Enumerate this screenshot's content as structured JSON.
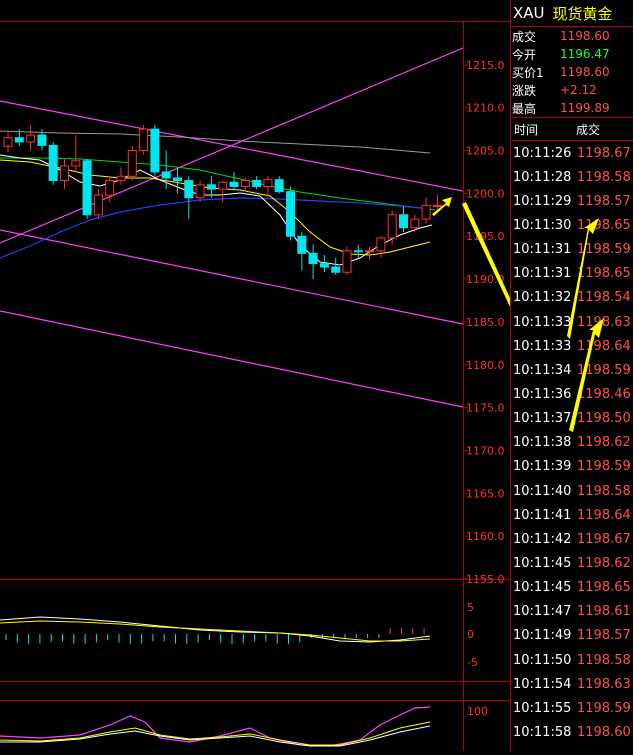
{
  "quote": {
    "symbol": "XAU",
    "name": "现货黄金",
    "rows": [
      {
        "label": "成交",
        "value": "1198.60",
        "color": "#ff5050"
      },
      {
        "label": "今开",
        "value": "1196.47",
        "color": "#20ff20"
      },
      {
        "label": "买价1",
        "value": "1198.60",
        "color": "#ff5050"
      },
      {
        "label": "涨跌",
        "value": "+2.12",
        "color": "#ff5050"
      },
      {
        "label": "最高",
        "value": "1199.89",
        "color": "#ff5050"
      }
    ]
  },
  "ticks_header": {
    "time": "时间",
    "price": "成交"
  },
  "ticks": [
    {
      "time": "10:11:26",
      "price": "1198.67"
    },
    {
      "time": "10:11:28",
      "price": "1198.58"
    },
    {
      "time": "10:11:29",
      "price": "1198.57"
    },
    {
      "time": "10:11:30",
      "price": "1198.65"
    },
    {
      "time": "10:11:31",
      "price": "1198.59"
    },
    {
      "time": "10:11:31",
      "price": "1198.65"
    },
    {
      "time": "10:11:32",
      "price": "1198.54"
    },
    {
      "time": "10:11:33",
      "price": "1198.63"
    },
    {
      "time": "10:11:33",
      "price": "1198.64"
    },
    {
      "time": "10:11:34",
      "price": "1198.59"
    },
    {
      "time": "10:11:36",
      "price": "1198.46"
    },
    {
      "time": "10:11:37",
      "price": "1198.50"
    },
    {
      "time": "10:11:38",
      "price": "1198.62"
    },
    {
      "time": "10:11:39",
      "price": "1198.59"
    },
    {
      "time": "10:11:40",
      "price": "1198.58"
    },
    {
      "time": "10:11:41",
      "price": "1198.64"
    },
    {
      "time": "10:11:42",
      "price": "1198.67"
    },
    {
      "time": "10:11:45",
      "price": "1198.62"
    },
    {
      "time": "10:11:45",
      "price": "1198.65"
    },
    {
      "time": "10:11:47",
      "price": "1198.61"
    },
    {
      "time": "10:11:49",
      "price": "1198.57"
    },
    {
      "time": "10:11:50",
      "price": "1198.58"
    },
    {
      "time": "10:11:54",
      "price": "1198.63"
    },
    {
      "time": "10:11:55",
      "price": "1198.59"
    },
    {
      "time": "10:11:58",
      "price": "1198.60"
    }
  ],
  "chart_data": {
    "type": "candlestick",
    "ylim": [
      1155,
      1220
    ],
    "yticks": [
      "1215.0",
      "1210.0",
      "1205.0",
      "1200.0",
      "1195.0",
      "1190.0",
      "1185.0",
      "1180.0",
      "1175.0",
      "1170.0",
      "1165.0",
      "1160.0",
      "1155.0"
    ],
    "colors": {
      "up": "#ff3030",
      "down": "#00e5ee",
      "grid": "#b00000",
      "channel": "#ff40ff",
      "ma1": "#ffffff",
      "ma2": "#ffff00",
      "ma3": "#00dd00",
      "ma4": "#2040ff"
    },
    "candles": [
      {
        "o": 1205.5,
        "h": 1207.2,
        "l": 1204.8,
        "c": 1206.5
      },
      {
        "o": 1206.5,
        "h": 1207.5,
        "l": 1205.5,
        "c": 1206.0
      },
      {
        "o": 1206.0,
        "h": 1208.0,
        "l": 1205.0,
        "c": 1206.8
      },
      {
        "o": 1206.8,
        "h": 1207.5,
        "l": 1205.0,
        "c": 1205.6
      },
      {
        "o": 1205.6,
        "h": 1206.0,
        "l": 1201.0,
        "c": 1201.5
      },
      {
        "o": 1201.5,
        "h": 1204.0,
        "l": 1200.5,
        "c": 1203.2
      },
      {
        "o": 1203.2,
        "h": 1206.8,
        "l": 1202.5,
        "c": 1203.8
      },
      {
        "o": 1203.8,
        "h": 1204.0,
        "l": 1197.0,
        "c": 1197.5
      },
      {
        "o": 1197.5,
        "h": 1200.5,
        "l": 1197.0,
        "c": 1199.8
      },
      {
        "o": 1199.8,
        "h": 1202.0,
        "l": 1199.0,
        "c": 1201.5
      },
      {
        "o": 1201.5,
        "h": 1203.0,
        "l": 1201.0,
        "c": 1202.0
      },
      {
        "o": 1202.0,
        "h": 1205.5,
        "l": 1201.5,
        "c": 1205.0
      },
      {
        "o": 1205.0,
        "h": 1208.0,
        "l": 1204.5,
        "c": 1207.5
      },
      {
        "o": 1207.5,
        "h": 1208.0,
        "l": 1202.0,
        "c": 1202.5
      },
      {
        "o": 1202.5,
        "h": 1205.0,
        "l": 1200.5,
        "c": 1201.8
      },
      {
        "o": 1201.8,
        "h": 1203.0,
        "l": 1200.0,
        "c": 1201.5
      },
      {
        "o": 1201.5,
        "h": 1202.0,
        "l": 1197.0,
        "c": 1199.5
      },
      {
        "o": 1199.5,
        "h": 1201.5,
        "l": 1199.0,
        "c": 1201.0
      },
      {
        "o": 1201.0,
        "h": 1202.0,
        "l": 1199.5,
        "c": 1200.5
      },
      {
        "o": 1200.5,
        "h": 1201.5,
        "l": 1199.0,
        "c": 1201.3
      },
      {
        "o": 1201.3,
        "h": 1202.5,
        "l": 1200.5,
        "c": 1200.8
      },
      {
        "o": 1200.8,
        "h": 1201.8,
        "l": 1200.2,
        "c": 1201.5
      },
      {
        "o": 1201.5,
        "h": 1202.0,
        "l": 1200.5,
        "c": 1200.8
      },
      {
        "o": 1200.8,
        "h": 1202.0,
        "l": 1199.5,
        "c": 1201.6
      },
      {
        "o": 1201.6,
        "h": 1202.0,
        "l": 1200.0,
        "c": 1200.2
      },
      {
        "o": 1200.2,
        "h": 1200.8,
        "l": 1194.5,
        "c": 1195.0
      },
      {
        "o": 1195.0,
        "h": 1195.5,
        "l": 1191.0,
        "c": 1193.0
      },
      {
        "o": 1193.0,
        "h": 1194.0,
        "l": 1190.0,
        "c": 1191.8
      },
      {
        "o": 1191.8,
        "h": 1192.8,
        "l": 1190.8,
        "c": 1191.4
      },
      {
        "o": 1191.4,
        "h": 1192.5,
        "l": 1190.5,
        "c": 1190.8
      },
      {
        "o": 1190.8,
        "h": 1193.8,
        "l": 1190.5,
        "c": 1193.3
      },
      {
        "o": 1193.3,
        "h": 1194.0,
        "l": 1192.5,
        "c": 1193.2
      },
      {
        "o": 1193.2,
        "h": 1193.8,
        "l": 1192.2,
        "c": 1193.3
      },
      {
        "o": 1193.3,
        "h": 1195.0,
        "l": 1192.5,
        "c": 1194.8
      },
      {
        "o": 1194.8,
        "h": 1198.0,
        "l": 1194.0,
        "c": 1197.5
      },
      {
        "o": 1197.5,
        "h": 1198.5,
        "l": 1195.5,
        "c": 1196.0
      },
      {
        "o": 1196.0,
        "h": 1197.5,
        "l": 1195.5,
        "c": 1197.0
      },
      {
        "o": 1197.0,
        "h": 1199.5,
        "l": 1196.5,
        "c": 1198.6
      },
      {
        "o": 1198.6,
        "h": 1199.9,
        "l": 1198.2,
        "c": 1198.6
      }
    ],
    "macd_yticks": [
      "5",
      "0",
      "-5"
    ],
    "kdj_yticks": [
      "100"
    ]
  }
}
